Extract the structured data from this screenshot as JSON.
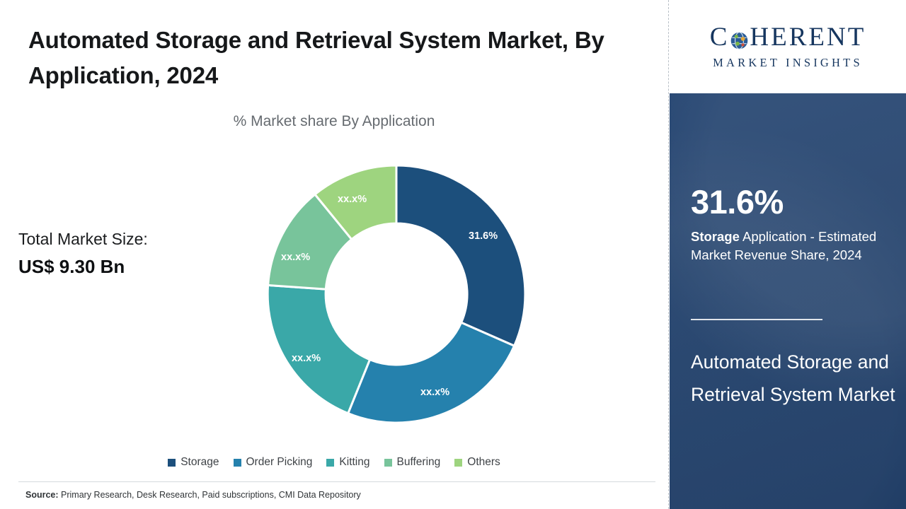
{
  "header": {
    "title": "Automated Storage and Retrieval System Market, By Application, 2024",
    "subtitle": "% Market share By Application"
  },
  "total": {
    "label": "Total Market Size:",
    "value": "US$ 9.30 Bn"
  },
  "source": {
    "prefix": "Source:",
    "text": " Primary Research, Desk Research, Paid subscriptions, CMI Data Repository"
  },
  "brand": {
    "name_main_pre": "C",
    "name_main_post": "HERENT",
    "name_sub": "MARKET INSIGHTS",
    "globe_icon": "globe-icon"
  },
  "highlight": {
    "percent": "31.6%",
    "desc_bold": "Storage",
    "desc_rest": " Application - Estimated Market Revenue Share, 2024",
    "market_name": "Automated Storage and Retrieval System Market"
  },
  "chart_data": {
    "type": "pie",
    "title": "Automated Storage and Retrieval System Market, By Application, 2024",
    "subtitle": "% Market share By Application",
    "categories": [
      "Storage",
      "Order Picking",
      "Kitting",
      "Buffering",
      "Others"
    ],
    "values": [
      31.6,
      24.5,
      20.0,
      13.0,
      10.9
    ],
    "labels": [
      "31.6%",
      "xx.x%",
      "xx.x%",
      "xx.x%",
      "xx.x%"
    ],
    "colors": [
      "#1c4f7c",
      "#2581ad",
      "#3aa8a8",
      "#78c49b",
      "#9ed47f"
    ],
    "legend_position": "bottom",
    "donut": true,
    "hole_ratio": 0.55
  },
  "legend": [
    {
      "label": "Storage",
      "color": "#1c4f7c"
    },
    {
      "label": "Order Picking",
      "color": "#2581ad"
    },
    {
      "label": "Kitting",
      "color": "#3aa8a8"
    },
    {
      "label": "Buffering",
      "color": "#78c49b"
    },
    {
      "label": "Others",
      "color": "#9ed47f"
    }
  ]
}
